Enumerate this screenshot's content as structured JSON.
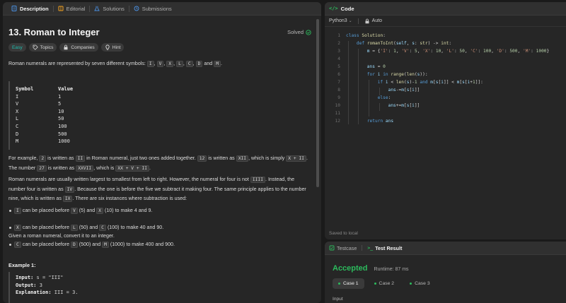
{
  "left_tabs": [
    "Description",
    "Editorial",
    "Solutions",
    "Submissions"
  ],
  "problem": {
    "title": "13. Roman to Integer",
    "status": "Solved",
    "chips": [
      "Easy",
      "Topics",
      "Companies",
      "Hint"
    ]
  },
  "intro": {
    "text": "Roman numerals are represented by seven different symbols: ",
    "symbols": [
      "I",
      "V",
      "X",
      "L",
      "C",
      "D",
      "M"
    ],
    "and": "and",
    "end": "."
  },
  "symbol_table": {
    "headers": [
      "Symbol",
      "Value"
    ],
    "rows": [
      [
        "I",
        "1"
      ],
      [
        "V",
        "5"
      ],
      [
        "X",
        "10"
      ],
      [
        "L",
        "50"
      ],
      [
        "C",
        "100"
      ],
      [
        "D",
        "500"
      ],
      [
        "M",
        "1000"
      ]
    ]
  },
  "para_example": {
    "s1": "For example, ",
    "c1": "2",
    "s2": " is written as ",
    "c2": "II",
    "s3": " in Roman numeral, just two ones added together. ",
    "c3": "12",
    "s4": " is written as ",
    "c4": "XII",
    "s5": ", which is simply ",
    "c5": "X + II",
    "s6": ". The number ",
    "c6": "27",
    "s7": " is written as ",
    "c7": "XXVII",
    "s8": ", which is ",
    "c8": "XX + V + II",
    "s9": "."
  },
  "para_order": {
    "s1": "Roman numerals are usually written largest to smallest from left to right. However, the numeral for four is not ",
    "c1": "IIII",
    "s2": ". Instead, the number four is written as ",
    "c2": "IV",
    "s3": ". Because the one is before the five we subtract it making four. The same principle applies to the number nine, which is written as ",
    "c3": "IX",
    "s4": ". There are six instances where subtraction is used:"
  },
  "bullets": [
    {
      "a": "I",
      "t1": " can be placed before ",
      "b": "V",
      "t2": " (5) and ",
      "c": "X",
      "t3": " (10) to make 4 and 9."
    },
    {
      "a": "X",
      "t1": " can be placed before ",
      "b": "L",
      "t2": " (50) and ",
      "c": "C",
      "t3": " (100) to make 40 and 90."
    },
    {
      "a": "C",
      "t1": " can be placed before ",
      "b": "D",
      "t2": " (500) and ",
      "c": "M",
      "t3": " (1000) to make 400 and 900."
    }
  ],
  "given": "Given a roman numeral, convert it to an integer.",
  "example1": {
    "title": "Example 1:",
    "input_label": "Input:",
    "input_value": "s = \"III\"",
    "output_label": "Output:",
    "output_value": "3",
    "explanation_label": "Explanation:",
    "explanation_value": "III = 3."
  },
  "code_panel": {
    "title": "Code",
    "language": "Python3",
    "mode": "Auto",
    "saved": "Saved to local",
    "line_numbers": [
      "1",
      "2",
      "3",
      "4",
      "5",
      "6",
      "7",
      "8",
      "9",
      "10",
      "11",
      "12"
    ]
  },
  "result_panel": {
    "tab_testcase": "Testcase",
    "tab_result": "Test Result",
    "status": "Accepted",
    "runtime": "Runtime: 87 ms",
    "cases": [
      "Case 1",
      "Case 2",
      "Case 3"
    ],
    "input_label": "Input"
  },
  "colors": {
    "accepted": "#2cbb5d",
    "easy": "#1cc0b0",
    "code_icon": "#2cbb5d"
  }
}
